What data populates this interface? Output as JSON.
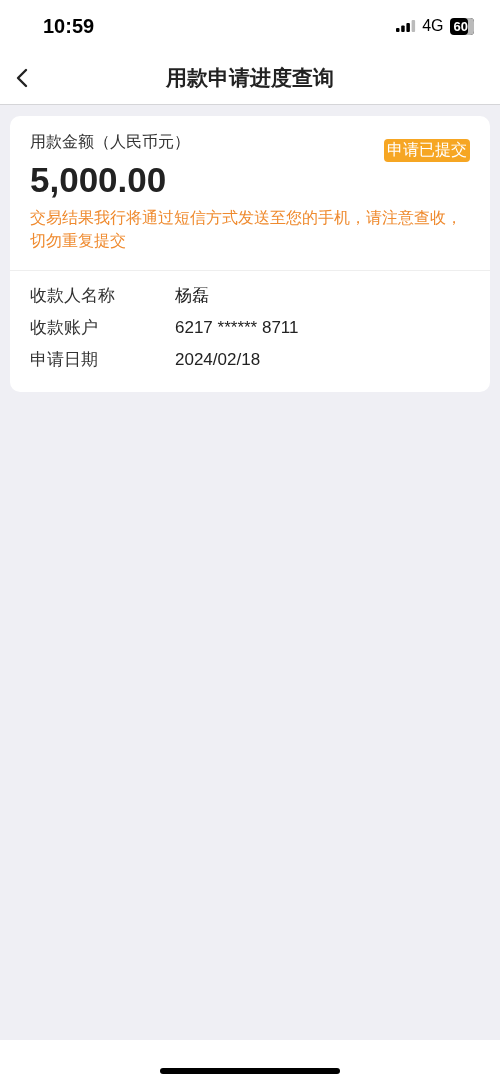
{
  "status_bar": {
    "time": "10:59",
    "network": "4G",
    "battery": "60"
  },
  "nav": {
    "title": "用款申请进度查询"
  },
  "card": {
    "amount_label": "用款金额（人民币元）",
    "status_badge": "申请已提交",
    "amount": "5,000.00",
    "notice": "交易结果我行将通过短信方式发送至您的手机，请注意查收，切勿重复提交",
    "details": [
      {
        "label": "收款人名称",
        "value": "杨磊"
      },
      {
        "label": "收款账户",
        "value": "6217 ****** 8711"
      },
      {
        "label": "申请日期",
        "value": "2024/02/18"
      }
    ]
  }
}
